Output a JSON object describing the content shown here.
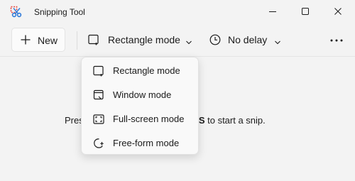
{
  "window": {
    "title": "Snipping Tool",
    "app_icon": "scissors-icon",
    "controls": [
      "minimize-icon",
      "maximize-icon",
      "close-icon"
    ]
  },
  "toolbar": {
    "new_label": "New",
    "new_icon": "plus-icon",
    "mode_label": "Rectangle mode",
    "mode_icon": "rectangle-mode-icon",
    "delay_label": "No delay",
    "delay_icon": "clock-icon",
    "more_icon": "more-icon"
  },
  "main": {
    "hint_start": "Pres",
    "hint_keys": "ift + S",
    "hint_end": " to start a snip."
  },
  "mode_menu": {
    "items": [
      {
        "label": "Rectangle mode",
        "icon": "rectangle-mode-icon"
      },
      {
        "label": "Window mode",
        "icon": "window-mode-icon"
      },
      {
        "label": "Full-screen mode",
        "icon": "fullscreen-mode-icon"
      },
      {
        "label": "Free-form mode",
        "icon": "freeform-mode-icon"
      }
    ]
  },
  "colors": {
    "background": "#f3f3f3",
    "menu_background": "#f9f9f9",
    "icon_red": "#e8463c",
    "icon_blue": "#2f7ad9",
    "text": "#1b1b1b"
  }
}
